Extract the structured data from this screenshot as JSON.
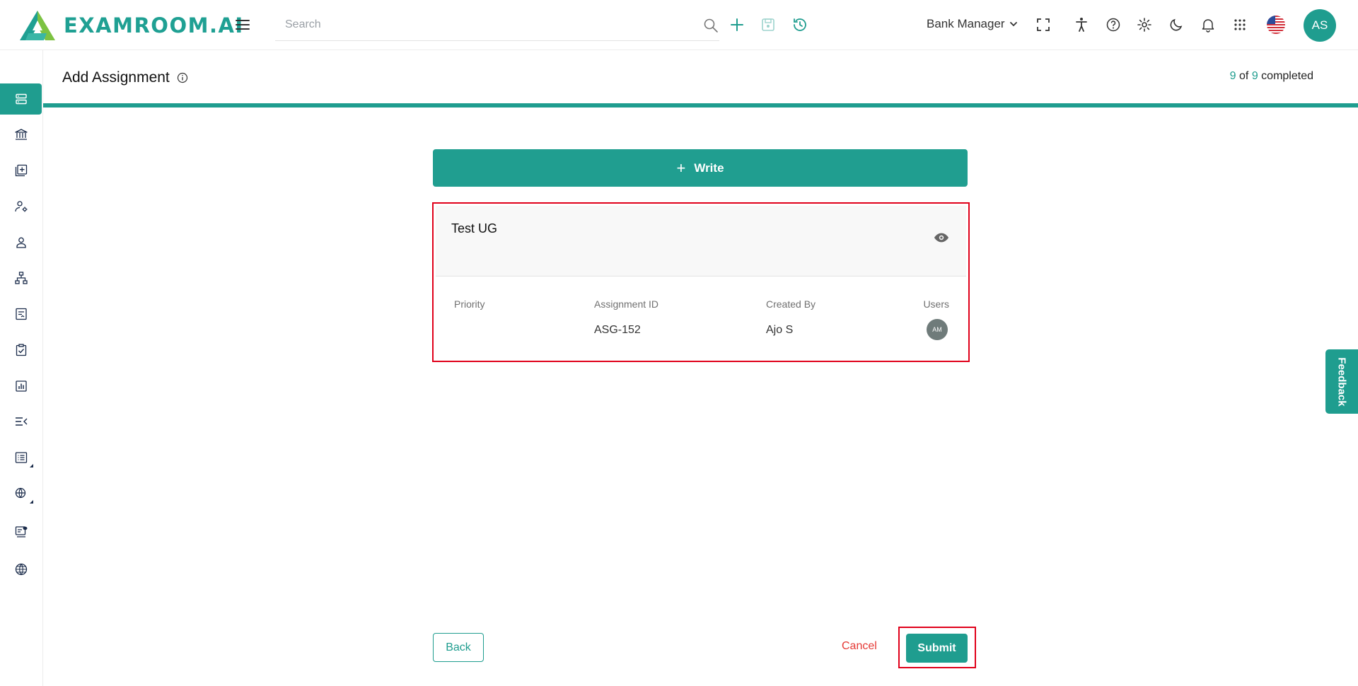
{
  "header": {
    "logo_text": "EXAMROOM.AI",
    "search_placeholder": "Search",
    "role_label": "Bank Manager",
    "avatar_initials": "AS"
  },
  "page": {
    "title": "Add Assignment",
    "progress_completed": "9",
    "progress_of": "of",
    "progress_total": "9",
    "progress_suffix": "completed",
    "progress_fraction": 1.0
  },
  "write_button": {
    "label": "Write"
  },
  "assignment_card": {
    "title": "Test UG",
    "columns": {
      "priority_label": "Priority",
      "priority_value": "",
      "assignment_id_label": "Assignment ID",
      "assignment_id_value": "ASG-152",
      "created_by_label": "Created By",
      "created_by_value": "Ajo S",
      "users_label": "Users",
      "user_initials": "AM"
    }
  },
  "footer": {
    "back_label": "Back",
    "cancel_label": "Cancel",
    "submit_label": "Submit"
  },
  "feedback_label": "Feedback",
  "colors": {
    "brand": "#1f9d8f",
    "highlight": "#e0001a",
    "cancel": "#e53935"
  }
}
